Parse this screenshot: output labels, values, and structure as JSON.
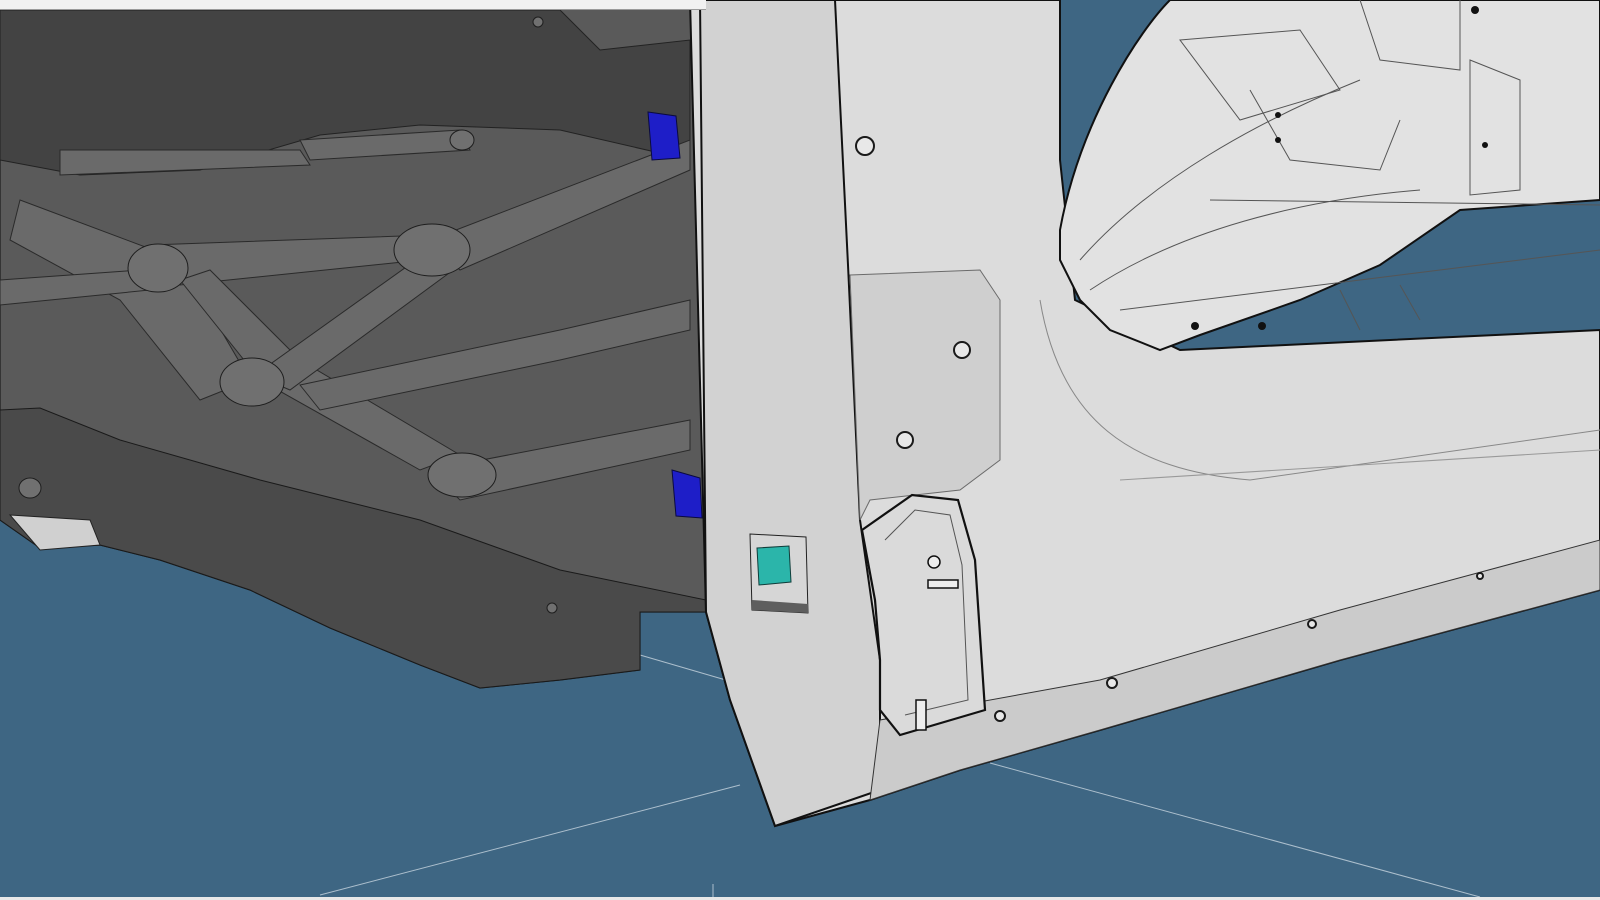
{
  "viewport": {
    "background": "#3e6683",
    "panel_fill": "#d9d9d9",
    "panel_edge": "#111111",
    "fill_color": "#5a5a5a",
    "marker_blue": "#1e1ec8",
    "marker_teal": "#2bb5aa"
  },
  "scene": {
    "objects": [
      "underbody-casting",
      "side-sill-panel",
      "rear-wheelhouse",
      "door-hinge-bracket",
      "blue-marker",
      "teal-marker"
    ]
  }
}
